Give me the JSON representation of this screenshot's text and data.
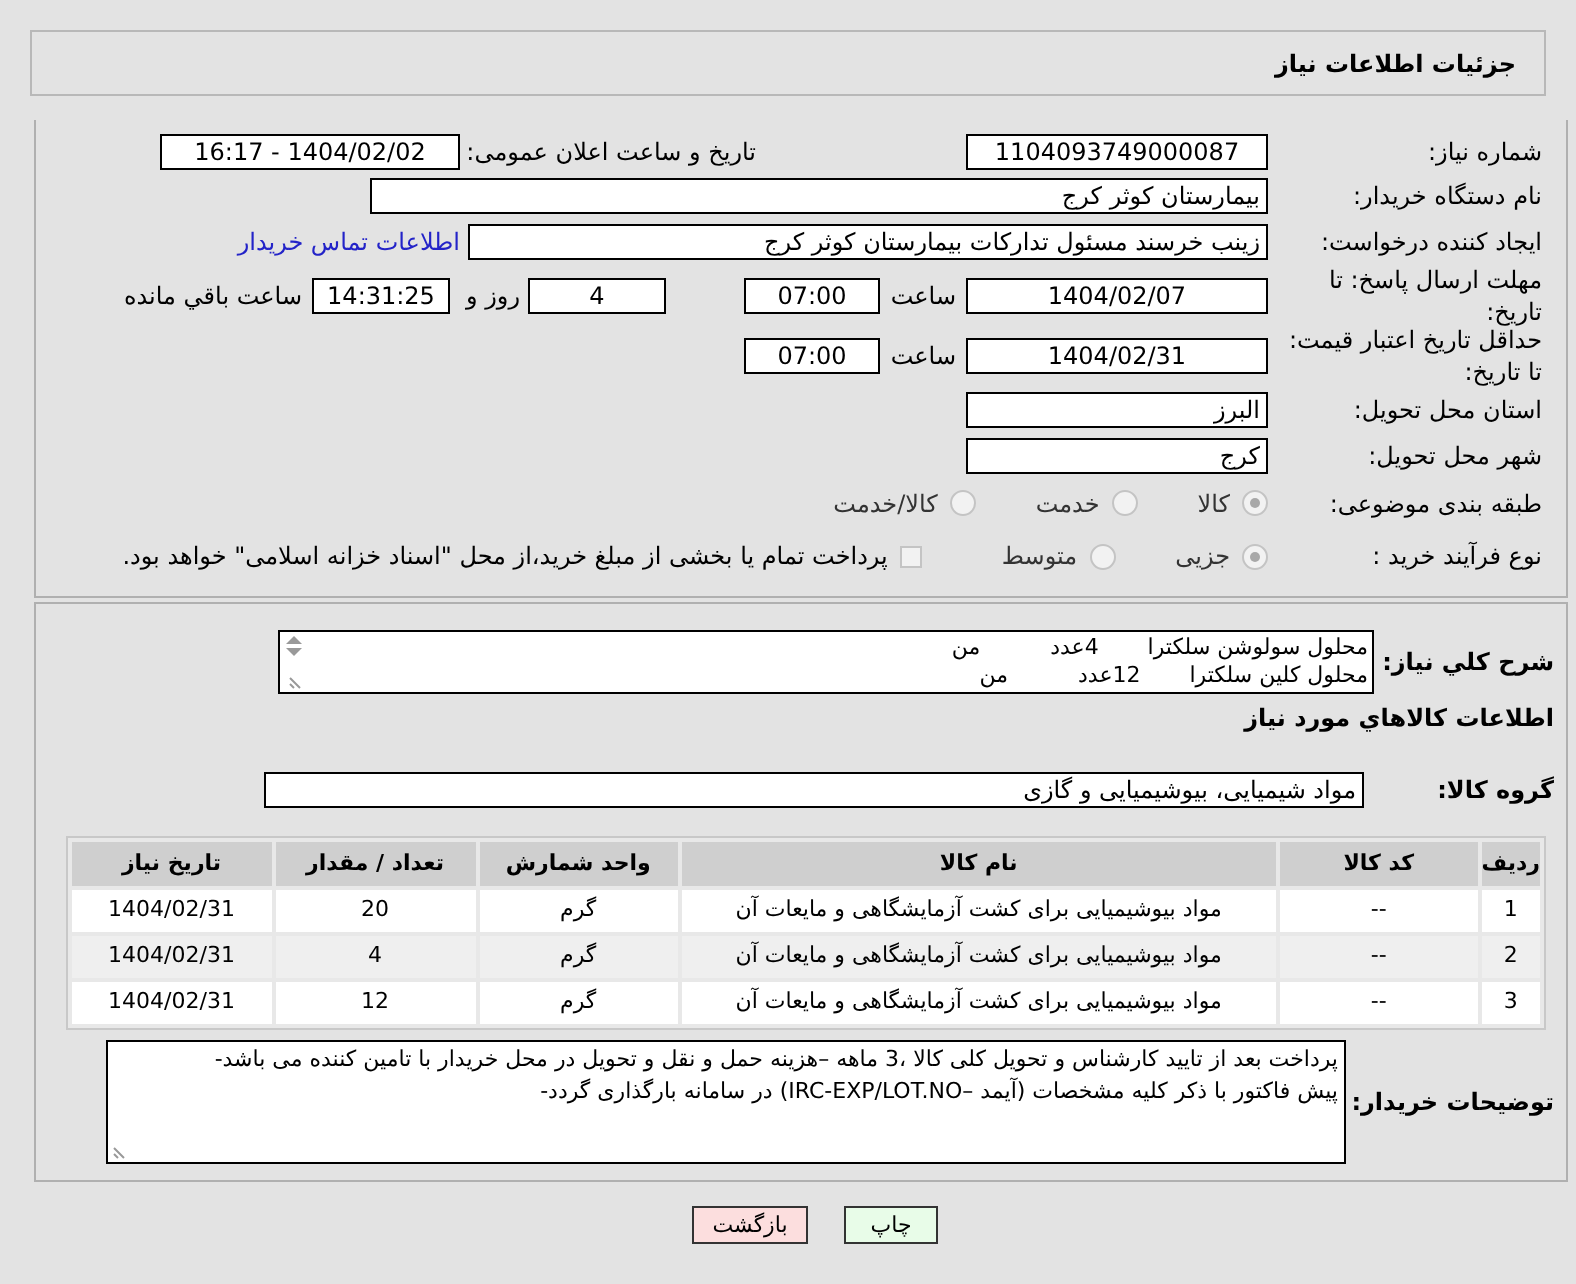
{
  "header": {
    "title": "جزئیات اطلاعات نیاز"
  },
  "need_number": {
    "label": "شماره نیاز:",
    "value": "1104093749000087"
  },
  "announce": {
    "label": "تاریخ و ساعت اعلان عمومی:",
    "value": "1404/02/02 - 16:17"
  },
  "buyer_org": {
    "label": "نام دستگاه خریدار:",
    "value": "بیمارستان کوثر کرج"
  },
  "requester": {
    "label": "ایجاد کننده درخواست:",
    "value": "زینب خرسند مسئول تدارکات بیمارستان کوثر کرج",
    "link": "اطلاعات تماس خریدار"
  },
  "reply_deadline": {
    "label": "مهلت ارسال پاسخ: تا تاریخ:",
    "date": "1404/02/07",
    "time_label": "ساعت",
    "time": "07:00",
    "days": "4",
    "days_label": "روز و",
    "remaining": "14:31:25",
    "remaining_label": "ساعت باقي مانده"
  },
  "price_validity": {
    "label": "حداقل تاریخ اعتبار قیمت: تا تاریخ:",
    "date": "1404/02/31",
    "time_label": "ساعت",
    "time": "07:00"
  },
  "province": {
    "label": "استان محل تحویل:",
    "value": "البرز"
  },
  "city": {
    "label": "شهر محل تحویل:",
    "value": "کرج"
  },
  "category": {
    "label": "طبقه بندی موضوعی:",
    "options": [
      {
        "label": "کالا",
        "selected": true
      },
      {
        "label": "خدمت",
        "selected": false
      },
      {
        "label": "کالا/خدمت",
        "selected": false
      }
    ]
  },
  "process": {
    "label": "نوع فرآیند خرید :",
    "options": [
      {
        "label": "جزیی",
        "selected": true
      },
      {
        "label": "متوسط",
        "selected": false
      }
    ],
    "treasury": {
      "checked": false,
      "text": "پرداخت تمام یا بخشی از مبلغ خرید،از محل \"اسناد خزانه اسلامی\" خواهد بود."
    }
  },
  "description": {
    "label": "شرح کلي نیاز:",
    "lines": [
      "محلول سولوشن سلکترا       4عدد          من",
      "محلول کلین سلکترا       12عدد          من"
    ]
  },
  "goods_heading": "اطلاعات کالاهاي مورد نیاز",
  "goods_group": {
    "label": "گروه کالا:",
    "value": "مواد شیمیایی، بیوشیمیایی و  گازی"
  },
  "table": {
    "columns": [
      "ردیف",
      "کد کالا",
      "نام کالا",
      "واحد شمارش",
      "تعداد / مقدار",
      "تاریخ نیاز"
    ],
    "rows": [
      [
        "1",
        "--",
        "مواد بیوشیمیایی برای کشت آزمایشگاهی و مایعات آن",
        "گرم",
        "20",
        "1404/02/31"
      ],
      [
        "2",
        "--",
        "مواد بیوشیمیایی برای کشت آزمایشگاهی و مایعات آن",
        "گرم",
        "4",
        "1404/02/31"
      ],
      [
        "3",
        "--",
        "مواد بیوشیمیایی برای کشت آزمایشگاهی و مایعات آن",
        "گرم",
        "12",
        "1404/02/31"
      ]
    ]
  },
  "buyer_notes": {
    "label": "توضیحات خریدار:",
    "lines": [
      "پرداخت بعد از تایید کارشناس و تحویل کلی کالا ،3 ماهه –هزینه حمل و نقل و تحویل در محل خریدار با تامین کننده می باشد-",
      "پیش فاکتور با ذکر کلیه مشخصات (آیمد –IRC-EXP/LOT.NO) در سامانه بارگذاری گردد-"
    ]
  },
  "buttons": [
    {
      "kind": "print",
      "label": "چاپ"
    },
    {
      "kind": "back",
      "label": "بازگشت"
    }
  ]
}
